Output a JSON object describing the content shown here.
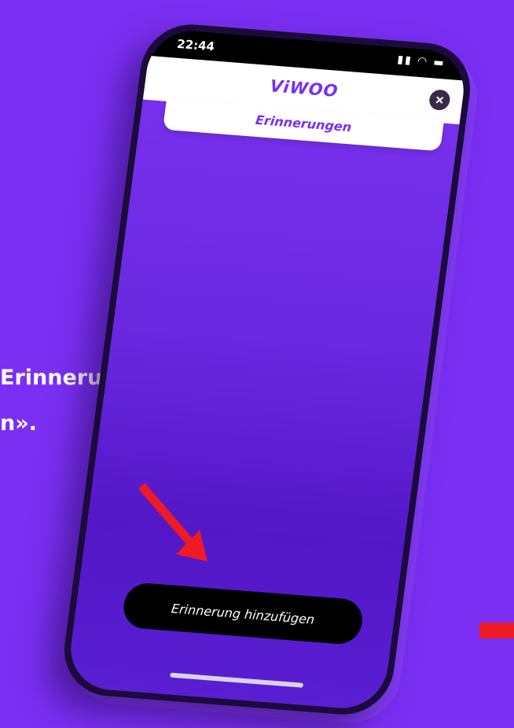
{
  "instruction": {
    "line1": "Erinnerung",
    "line2": "n»."
  },
  "status_bar": {
    "time": "22:44",
    "icons": "signal-icon wifi-icon battery-icon"
  },
  "header": {
    "title": "ViWOO",
    "close_icon": "close-icon"
  },
  "tab": {
    "label": "Erinnerungen"
  },
  "main": {
    "add_button_label": "Erinnerung hinzufügen"
  },
  "colors": {
    "background": "#7a2ff2",
    "accent": "#7a2ff2",
    "arrow": "#ee1b24",
    "button": "#000000"
  }
}
